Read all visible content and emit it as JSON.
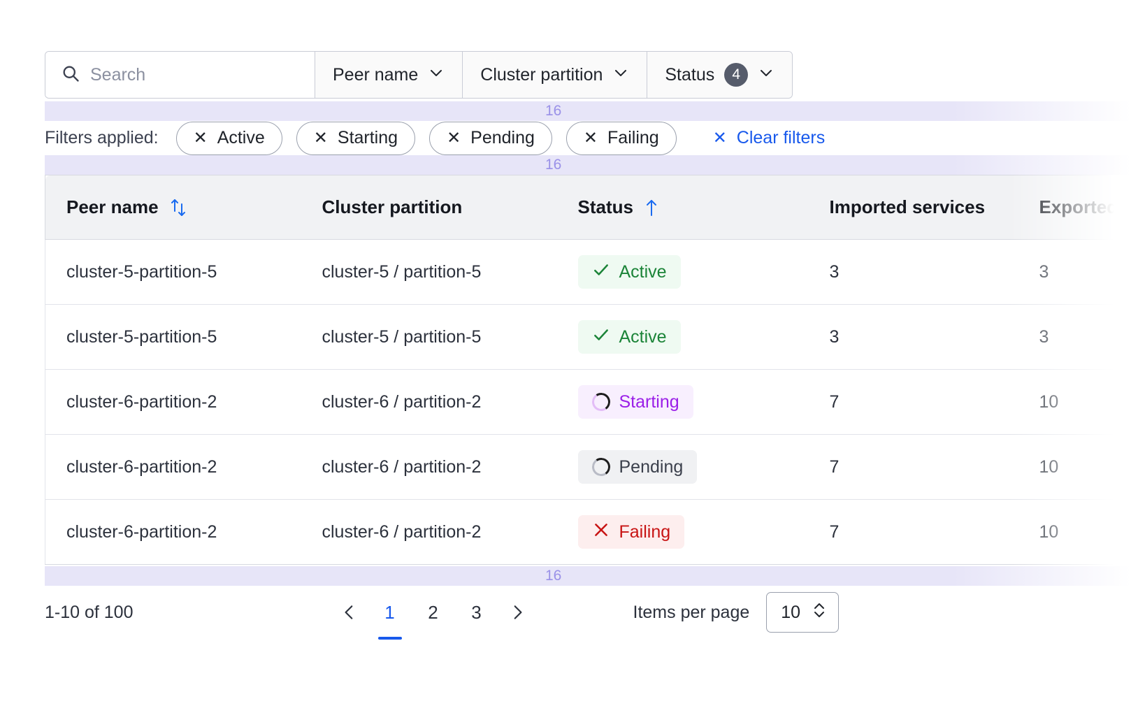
{
  "toolbar": {
    "search_placeholder": "Search",
    "search_value": "",
    "search_icon": "search-icon",
    "filters": [
      {
        "label": "Peer name",
        "chevron": "chevron-down-icon"
      },
      {
        "label": "Cluster partition",
        "chevron": "chevron-down-icon"
      },
      {
        "label": "Status",
        "badge": "4",
        "chevron": "chevron-down-icon"
      }
    ]
  },
  "applied_filters": {
    "label": "Filters applied:",
    "chips": [
      "Active",
      "Starting",
      "Pending",
      "Failing"
    ],
    "clear_label": "Clear filters",
    "remove_icon": "close-icon"
  },
  "spacing_markers": [
    {
      "value": "16"
    },
    {
      "value": "16"
    },
    {
      "value": "16"
    }
  ],
  "table": {
    "columns": [
      {
        "key": "peer",
        "label": "Peer name",
        "sort": "unsorted-icon"
      },
      {
        "key": "partition",
        "label": "Cluster partition",
        "sort": "none"
      },
      {
        "key": "status",
        "label": "Status",
        "sort": "sort-ascending-icon"
      },
      {
        "key": "imported",
        "label": "Imported services",
        "sort": "none"
      },
      {
        "key": "exported",
        "label": "Exported services",
        "sort": "none"
      }
    ],
    "rows": [
      {
        "peer": "cluster-5-partition-5",
        "partition": "cluster-5 / partition-5",
        "status": "Active",
        "status_kind": "active",
        "status_icon": "check-icon",
        "imported": "3",
        "exported": "3"
      },
      {
        "peer": "cluster-5-partition-5",
        "partition": "cluster-5 / partition-5",
        "status": "Active",
        "status_kind": "active",
        "status_icon": "check-icon",
        "imported": "3",
        "exported": "3"
      },
      {
        "peer": "cluster-6-partition-2",
        "partition": "cluster-6 / partition-2",
        "status": "Starting",
        "status_kind": "starting",
        "status_icon": "spinner-icon",
        "imported": "7",
        "exported": "10"
      },
      {
        "peer": "cluster-6-partition-2",
        "partition": "cluster-6 / partition-2",
        "status": "Pending",
        "status_kind": "pending",
        "status_icon": "spinner-icon",
        "imported": "7",
        "exported": "10"
      },
      {
        "peer": "cluster-6-partition-2",
        "partition": "cluster-6 / partition-2",
        "status": "Failing",
        "status_kind": "failing",
        "status_icon": "close-icon",
        "imported": "7",
        "exported": "10"
      }
    ]
  },
  "footer": {
    "range": "1-10 of 100",
    "prev_icon": "chevron-left-icon",
    "next_icon": "chevron-right-icon",
    "pages": [
      "1",
      "2",
      "3"
    ],
    "active_page": "1",
    "items_per_page_label": "Items per page",
    "items_per_page_value": "10",
    "items_per_page_icon": "stepper-icon"
  },
  "colors": {
    "accent_blue": "#1859ec",
    "status_active": "#1b8438",
    "status_starting": "#9b1fe8",
    "status_pending": "#3b404c",
    "status_failing": "#c81414",
    "spacing_marker": "#9a91e8",
    "badge_bg": "#565c6b"
  }
}
